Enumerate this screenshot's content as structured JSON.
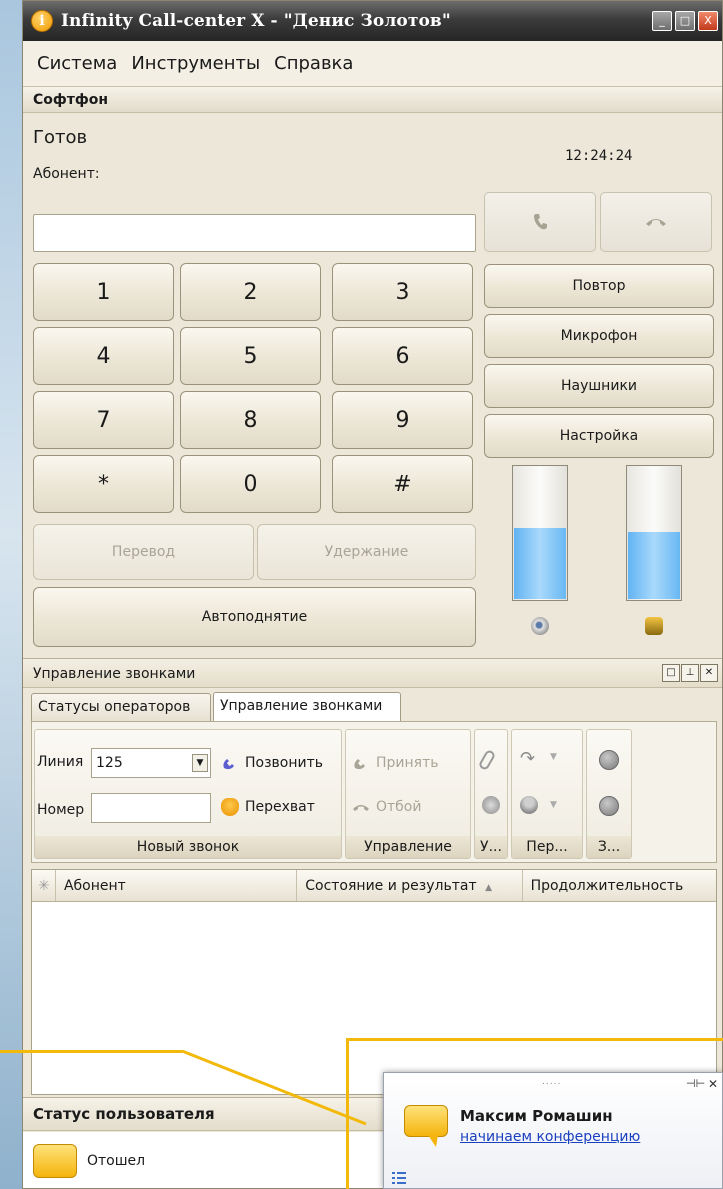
{
  "window": {
    "title": "Infinity Call-center X - \"Денис Золотов\"",
    "controls": {
      "minimize": "_",
      "maximize": "□",
      "close": "X"
    }
  },
  "menu": [
    "Система",
    "Инструменты",
    "Справка"
  ],
  "softphone": {
    "header": "Софтфон",
    "status": "Готов",
    "abonent_label": "Абонент:",
    "clock": "12:24:24",
    "number_value": "",
    "keys": [
      "1",
      "2",
      "3",
      "4",
      "5",
      "6",
      "7",
      "8",
      "9",
      "*",
      "0",
      "#"
    ],
    "transfer_label": "Перевод",
    "hold_label": "Удержание",
    "autoanswer_label": "Автоподнятие",
    "side_buttons": [
      "Повтор",
      "Микрофон",
      "Наушники",
      "Настройка"
    ],
    "speaker_level": 0.53,
    "mic_level": 0.5,
    "icons": {
      "call": "phone-handset-icon",
      "hangup": "hangup-icon",
      "speaker": "speaker-icon",
      "mic": "microphone-icon"
    }
  },
  "call_management": {
    "header": "Управление звонками",
    "tabs": [
      "Статусы операторов",
      "Управление звонками"
    ],
    "active_tab": 1,
    "line_label": "Линия",
    "line_value": "125",
    "number_label": "Номер",
    "number_value": "",
    "call_label": "Позвонить",
    "intercept_label": "Перехват",
    "accept_label": "Принять",
    "reject_label": "Отбой",
    "groups": [
      "Новый звонок",
      "Управление",
      "У...",
      "Пер...",
      "З..."
    ],
    "columns": [
      "Абонент",
      "Состояние и результат",
      "Продолжительность"
    ],
    "sort_indicator": "▲"
  },
  "user_status": {
    "header": "Статус пользователя",
    "status": "Отошел"
  },
  "notification": {
    "grip": ".....",
    "pin": "⊣⊢",
    "close": "✕",
    "sender": "Максим Ромашин",
    "message": "начинаем конференцию"
  },
  "colors": {
    "title_bar": "#3c3c3c",
    "accent_yellow": "#f2b90a",
    "meter_blue": "#61b3f2",
    "link_blue": "#1a3fbf"
  }
}
